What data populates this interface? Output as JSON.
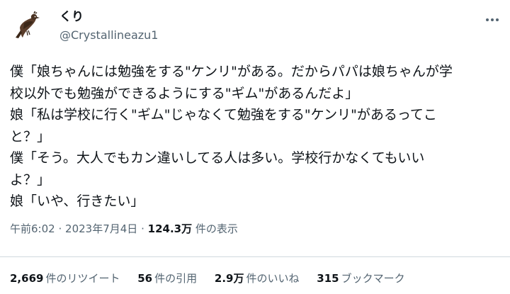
{
  "author": {
    "name": "くり",
    "handle": "@Crystallineazu1",
    "avatar_icon": "bird-icon"
  },
  "tweet": {
    "lines": [
      "僕「娘ちゃんには勉強をする\"ケンリ\"がある。だからパパは娘ちゃんが学",
      "校以外でも勉強ができるようにする\"ギム\"があるんだよ」",
      "娘「私は学校に行く\"ギム\"じゃなくて勉強をする\"ケンリ\"があるってこ",
      "と？」",
      "僕「そう。大人でもカン違いしてる人は多い。学校行かなくてもいい",
      "よ？」",
      "娘「いや、行きたい」"
    ]
  },
  "meta": {
    "time": "午前6:02",
    "separator": "·",
    "date": "2023年7月4日",
    "views_count": "124.3万",
    "views_label": "件の表示"
  },
  "stats": [
    {
      "count": "2,669",
      "label": "件のリツイート"
    },
    {
      "count": "56",
      "label": "件の引用"
    },
    {
      "count": "2.9万",
      "label": "件のいいね"
    },
    {
      "count": "315",
      "label": "ブックマーク"
    }
  ],
  "icons": {
    "more": "more-options-icon"
  },
  "colors": {
    "text": "#0f1419",
    "secondary": "#536471",
    "divider": "#cfd9de"
  }
}
